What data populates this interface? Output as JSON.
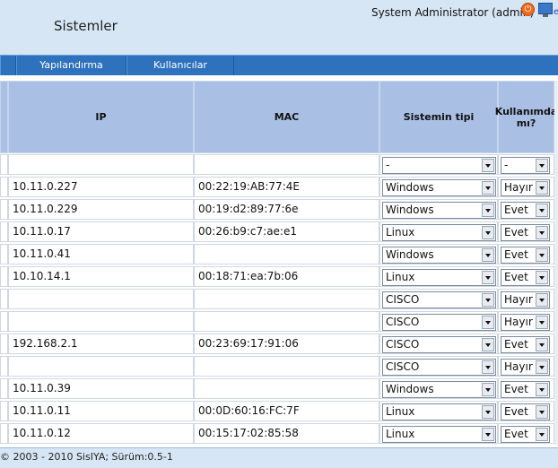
{
  "header": {
    "title": "Sistemler",
    "user": "System Administrator (admin)",
    "edge_link": "e"
  },
  "nav": {
    "items": [
      "Yapılandırma",
      "Kullanıcılar"
    ]
  },
  "table": {
    "columns": {
      "ip": "IP",
      "mac": "MAC",
      "type": "Sistemin tipi",
      "in_use": "Kullanımda mı?"
    },
    "filter": {
      "type": "-",
      "in_use": "-"
    },
    "rows": [
      {
        "ip": "10.11.0.227",
        "mac": "00:22:19:AB:77:4E",
        "type": "Windows",
        "in_use": "Hayır"
      },
      {
        "ip": "10.11.0.229",
        "mac": "00:19:d2:89:77:6e",
        "type": "Windows",
        "in_use": "Evet"
      },
      {
        "ip": "10.11.0.17",
        "mac": "00:26:b9:c7:ae:e1",
        "type": "Linux",
        "in_use": "Evet"
      },
      {
        "ip": "10.11.0.41",
        "mac": "",
        "type": "Windows",
        "in_use": "Evet"
      },
      {
        "ip": "10.10.14.1",
        "mac": "00:18:71:ea:7b:06",
        "type": "Linux",
        "in_use": "Evet"
      },
      {
        "ip": "",
        "mac": "",
        "type": "CISCO",
        "in_use": "Hayır"
      },
      {
        "ip": "",
        "mac": "",
        "type": "CISCO",
        "in_use": "Hayır"
      },
      {
        "ip": "192.168.2.1",
        "mac": "00:23:69:17:91:06",
        "type": "CISCO",
        "in_use": "Evet"
      },
      {
        "ip": "",
        "mac": "",
        "type": "CISCO",
        "in_use": "Hayır"
      },
      {
        "ip": "10.11.0.39",
        "mac": "",
        "type": "Windows",
        "in_use": "Evet"
      },
      {
        "ip": "10.11.0.11",
        "mac": "00:0D:60:16:FC:7F",
        "type": "Linux",
        "in_use": "Evet"
      },
      {
        "ip": "10.11.0.12",
        "mac": "00:15:17:02:85:58",
        "type": "Linux",
        "in_use": "Evet"
      }
    ]
  },
  "footer": {
    "text": "© 2003 - 2010 SisIYA; Sürüm:0.5-1"
  }
}
